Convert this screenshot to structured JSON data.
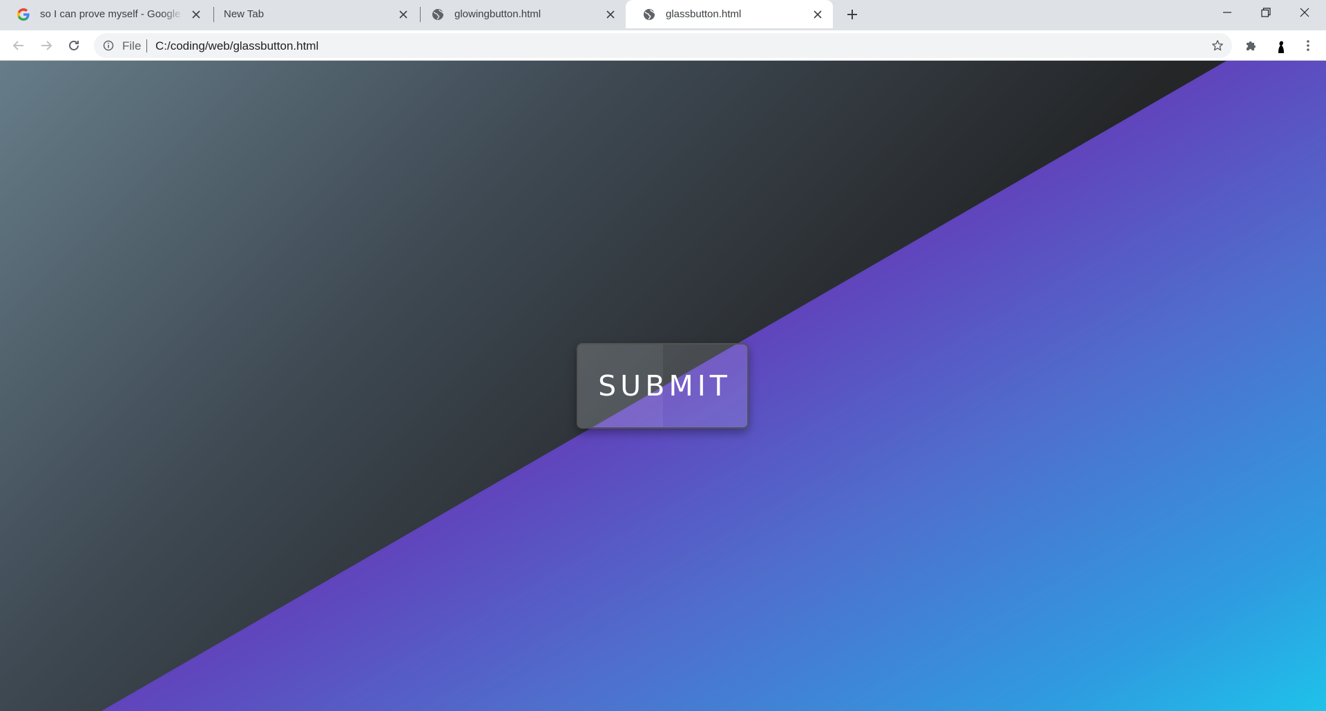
{
  "tabs": [
    {
      "title": "so I can prove myself - Google Search",
      "favicon": "google-icon",
      "active": false
    },
    {
      "title": "New Tab",
      "favicon": "",
      "active": false
    },
    {
      "title": "glowingbutton.html",
      "favicon": "globe-icon",
      "active": false
    },
    {
      "title": "glassbutton.html",
      "favicon": "globe-icon",
      "active": true
    }
  ],
  "address_bar": {
    "scheme": "File",
    "url": "C:/coding/web/glassbutton.html"
  },
  "page": {
    "button_label": "SUBMIT"
  },
  "colors": {
    "tabstrip_bg": "#dee1e6",
    "active_tab_bg": "#ffffff",
    "gradient_purple": "#6a32b8",
    "gradient_cyan": "#1ec2ea",
    "dark_bg": "#242628"
  }
}
